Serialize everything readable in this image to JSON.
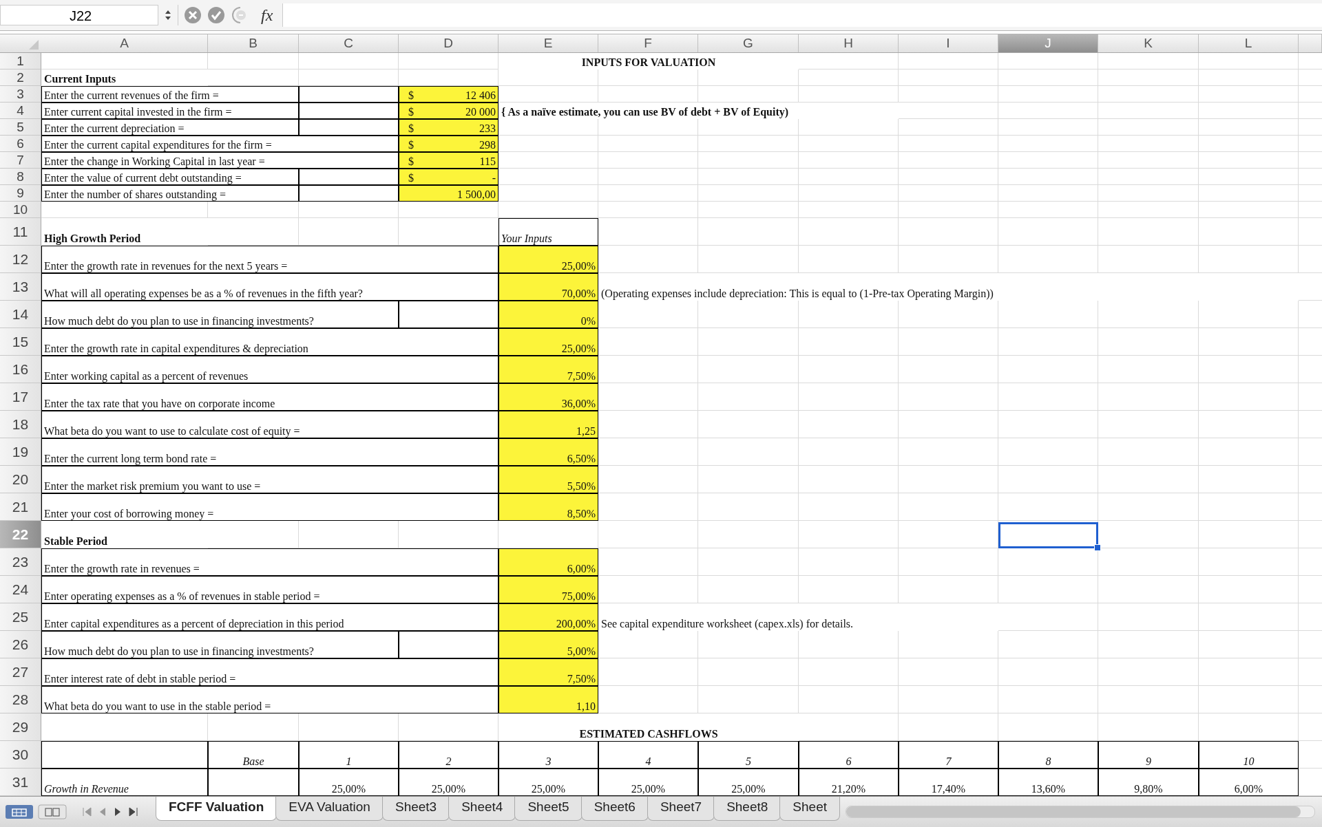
{
  "formula_bar": {
    "name_box": "J22",
    "fx_label": "fx"
  },
  "columns": [
    {
      "label": "A",
      "selected": false
    },
    {
      "label": "B",
      "selected": false
    },
    {
      "label": "C",
      "selected": false
    },
    {
      "label": "D",
      "selected": false
    },
    {
      "label": "E",
      "selected": false
    },
    {
      "label": "F",
      "selected": false
    },
    {
      "label": "G",
      "selected": false
    },
    {
      "label": "H",
      "selected": false
    },
    {
      "label": "I",
      "selected": false
    },
    {
      "label": "J",
      "selected": true
    },
    {
      "label": "K",
      "selected": false
    },
    {
      "label": "L",
      "selected": false
    }
  ],
  "rows": [
    {
      "number": "1",
      "selected": false,
      "cells": [
        {
          "kind": "blank"
        },
        {
          "kind": "blank"
        },
        {
          "kind": "blank"
        },
        {
          "kind": "blank"
        },
        {
          "kind": "title",
          "text": "INPUTS FOR VALUATION"
        },
        {
          "kind": "merged"
        },
        {
          "kind": "merged"
        }
      ]
    },
    {
      "number": "2",
      "selected": false,
      "cells": [
        {
          "kind": "heading",
          "text": "Current Inputs"
        }
      ]
    },
    {
      "number": "3",
      "selected": false,
      "cells": [
        {
          "kind": "label",
          "text": "Enter the current revenues of the firm ="
        },
        {
          "kind": "merged"
        },
        {
          "kind": "box"
        },
        {
          "kind": "money",
          "symbol": "$",
          "text": "12 406"
        }
      ]
    },
    {
      "number": "4",
      "selected": false,
      "cells": [
        {
          "kind": "label",
          "text": "Enter current capital invested in the firm ="
        },
        {
          "kind": "merged"
        },
        {
          "kind": "box"
        },
        {
          "kind": "money",
          "symbol": "$",
          "text": "20 000"
        },
        {
          "kind": "bold_note",
          "text": "{ As a naïve estimate, you can use BV of debt + BV of Equity)"
        },
        {
          "kind": "merged"
        },
        {
          "kind": "merged"
        },
        {
          "kind": "merged"
        }
      ]
    },
    {
      "number": "5",
      "selected": false,
      "cells": [
        {
          "kind": "label",
          "text": "Enter the current depreciation ="
        },
        {
          "kind": "merged"
        },
        {
          "kind": "box"
        },
        {
          "kind": "money",
          "symbol": "$",
          "text": "233"
        }
      ]
    },
    {
      "number": "6",
      "selected": false,
      "cells": [
        {
          "kind": "label",
          "text": "Enter the current capital expenditures for the firm ="
        },
        {
          "kind": "merged"
        },
        {
          "kind": "merged"
        },
        {
          "kind": "money",
          "symbol": "$",
          "text": "298"
        }
      ]
    },
    {
      "number": "7",
      "selected": false,
      "cells": [
        {
          "kind": "label",
          "text": "Enter the change in Working Capital in last year ="
        },
        {
          "kind": "merged"
        },
        {
          "kind": "merged"
        },
        {
          "kind": "money",
          "symbol": "$",
          "text": "115"
        }
      ]
    },
    {
      "number": "8",
      "selected": false,
      "cells": [
        {
          "kind": "label",
          "text": "Enter the value of current debt outstanding ="
        },
        {
          "kind": "merged"
        },
        {
          "kind": "box"
        },
        {
          "kind": "money",
          "symbol": "$",
          "text": "-"
        }
      ]
    },
    {
      "number": "9",
      "selected": false,
      "cells": [
        {
          "kind": "label",
          "text": "Enter the number of shares outstanding ="
        },
        {
          "kind": "merged"
        },
        {
          "kind": "box"
        },
        {
          "kind": "input",
          "text": "1 500,00"
        }
      ]
    },
    {
      "number": "10",
      "selected": false,
      "cells": []
    },
    {
      "number": "11",
      "selected": false,
      "cells": [
        {
          "kind": "heading",
          "text": "High Growth Period"
        },
        {
          "kind": "blank"
        },
        {
          "kind": "blank"
        },
        {
          "kind": "blank"
        },
        {
          "kind": "italic_box",
          "text": "Your Inputs"
        }
      ]
    },
    {
      "number": "12",
      "selected": false,
      "cells": [
        {
          "kind": "label",
          "text": "Enter the growth rate in revenues for the next 5 years ="
        },
        {
          "kind": "merged"
        },
        {
          "kind": "merged"
        },
        {
          "kind": "merged"
        },
        {
          "kind": "input",
          "text": "25,00%"
        }
      ]
    },
    {
      "number": "13",
      "selected": false,
      "cells": [
        {
          "kind": "label",
          "text": "What will all operating expenses be as a % of revenues in the fifth year?"
        },
        {
          "kind": "merged"
        },
        {
          "kind": "merged"
        },
        {
          "kind": "merged"
        },
        {
          "kind": "input",
          "text": "70,00%"
        },
        {
          "kind": "note",
          "text": "(Operating expenses include depreciation: This is equal to (1-Pre-tax Operating Margin))"
        },
        {
          "kind": "merged"
        },
        {
          "kind": "merged"
        },
        {
          "kind": "merged"
        },
        {
          "kind": "merged"
        },
        {
          "kind": "merged"
        },
        {
          "kind": "merged"
        }
      ]
    },
    {
      "number": "14",
      "selected": false,
      "cells": [
        {
          "kind": "label",
          "text": "How much debt do you plan to use in financing investments?"
        },
        {
          "kind": "merged"
        },
        {
          "kind": "merged"
        },
        {
          "kind": "box"
        },
        {
          "kind": "input",
          "text": "0%"
        }
      ]
    },
    {
      "number": "15",
      "selected": false,
      "cells": [
        {
          "kind": "label",
          "text": "Enter the growth rate in capital expenditures & depreciation"
        },
        {
          "kind": "merged"
        },
        {
          "kind": "merged"
        },
        {
          "kind": "merged"
        },
        {
          "kind": "input",
          "text": "25,00%"
        }
      ]
    },
    {
      "number": "16",
      "selected": false,
      "cells": [
        {
          "kind": "label",
          "text": "Enter working capital as a percent of revenues"
        },
        {
          "kind": "merged"
        },
        {
          "kind": "merged"
        },
        {
          "kind": "merged"
        },
        {
          "kind": "input",
          "text": "7,50%"
        }
      ]
    },
    {
      "number": "17",
      "selected": false,
      "cells": [
        {
          "kind": "label",
          "text": "Enter the tax rate that you have on corporate income"
        },
        {
          "kind": "merged"
        },
        {
          "kind": "merged"
        },
        {
          "kind": "merged"
        },
        {
          "kind": "input",
          "text": "36,00%"
        }
      ]
    },
    {
      "number": "18",
      "selected": false,
      "cells": [
        {
          "kind": "label",
          "text": "What beta do you want to use to calculate cost of equity ="
        },
        {
          "kind": "merged"
        },
        {
          "kind": "merged"
        },
        {
          "kind": "merged"
        },
        {
          "kind": "input",
          "text": "1,25"
        }
      ]
    },
    {
      "number": "19",
      "selected": false,
      "cells": [
        {
          "kind": "label",
          "text": "Enter the current long term bond rate ="
        },
        {
          "kind": "merged"
        },
        {
          "kind": "merged"
        },
        {
          "kind": "merged"
        },
        {
          "kind": "input",
          "text": "6,50%"
        }
      ]
    },
    {
      "number": "20",
      "selected": false,
      "cells": [
        {
          "kind": "label",
          "text": "Enter the market risk premium you want to use ="
        },
        {
          "kind": "merged"
        },
        {
          "kind": "merged"
        },
        {
          "kind": "merged"
        },
        {
          "kind": "input",
          "text": "5,50%"
        }
      ]
    },
    {
      "number": "21",
      "selected": false,
      "cells": [
        {
          "kind": "label",
          "text": "Enter your cost of borrowing money ="
        },
        {
          "kind": "merged"
        },
        {
          "kind": "merged"
        },
        {
          "kind": "merged"
        },
        {
          "kind": "input",
          "text": "8,50%"
        }
      ]
    },
    {
      "number": "22",
      "selected": true,
      "cells": [
        {
          "kind": "heading",
          "text": "Stable Period"
        },
        {
          "kind": "blank"
        },
        {
          "kind": "blank"
        },
        {
          "kind": "blank"
        },
        {
          "kind": "blank"
        },
        {
          "kind": "blank"
        },
        {
          "kind": "blank"
        },
        {
          "kind": "blank"
        },
        {
          "kind": "blank"
        },
        {
          "kind": "cursor"
        }
      ]
    },
    {
      "number": "23",
      "selected": false,
      "cells": [
        {
          "kind": "label",
          "text": "Enter the growth rate in revenues ="
        },
        {
          "kind": "merged"
        },
        {
          "kind": "merged"
        },
        {
          "kind": "merged"
        },
        {
          "kind": "input",
          "text": "6,00%"
        }
      ]
    },
    {
      "number": "24",
      "selected": false,
      "cells": [
        {
          "kind": "label",
          "text": "Enter operating expenses as a % of revenues in stable period ="
        },
        {
          "kind": "merged"
        },
        {
          "kind": "merged"
        },
        {
          "kind": "merged"
        },
        {
          "kind": "input",
          "text": "75,00%"
        }
      ]
    },
    {
      "number": "25",
      "selected": false,
      "cells": [
        {
          "kind": "label",
          "text": "Enter capital expenditures as a percent of depreciation in this period"
        },
        {
          "kind": "merged"
        },
        {
          "kind": "merged"
        },
        {
          "kind": "merged"
        },
        {
          "kind": "input",
          "text": "200,00%"
        },
        {
          "kind": "note",
          "text": "See capital expenditure worksheet (capex.xls) for details."
        },
        {
          "kind": "merged"
        },
        {
          "kind": "merged"
        },
        {
          "kind": "merged"
        }
      ]
    },
    {
      "number": "26",
      "selected": false,
      "cells": [
        {
          "kind": "label",
          "text": "How much debt do you plan to use in financing investments?"
        },
        {
          "kind": "merged"
        },
        {
          "kind": "merged"
        },
        {
          "kind": "box"
        },
        {
          "kind": "input",
          "text": "5,00%"
        }
      ]
    },
    {
      "number": "27",
      "selected": false,
      "cells": [
        {
          "kind": "label",
          "text": "Enter interest rate of debt in stable period ="
        },
        {
          "kind": "merged"
        },
        {
          "kind": "merged"
        },
        {
          "kind": "merged"
        },
        {
          "kind": "input",
          "text": "7,50%"
        }
      ]
    },
    {
      "number": "28",
      "selected": false,
      "cells": [
        {
          "kind": "label",
          "text": "What beta do you want to use in the stable period ="
        },
        {
          "kind": "merged"
        },
        {
          "kind": "merged"
        },
        {
          "kind": "merged"
        },
        {
          "kind": "input",
          "text": "1,10"
        }
      ]
    },
    {
      "number": "29",
      "selected": false,
      "cells": [
        {
          "kind": "blank"
        },
        {
          "kind": "blank"
        },
        {
          "kind": "blank"
        },
        {
          "kind": "blank"
        },
        {
          "kind": "title",
          "text": "ESTIMATED CASHFLOWS"
        },
        {
          "kind": "merged"
        },
        {
          "kind": "merged"
        }
      ]
    },
    {
      "number": "30",
      "selected": false,
      "cells": [
        {
          "kind": "box"
        },
        {
          "kind": "italic_head",
          "text": "Base"
        },
        {
          "kind": "italic_head",
          "text": "1"
        },
        {
          "kind": "italic_head",
          "text": "2"
        },
        {
          "kind": "italic_head",
          "text": "3"
        },
        {
          "kind": "italic_head",
          "text": "4"
        },
        {
          "kind": "italic_head",
          "text": "5"
        },
        {
          "kind": "italic_head",
          "text": "6"
        },
        {
          "kind": "italic_head",
          "text": "7"
        },
        {
          "kind": "italic_head",
          "text": "8"
        },
        {
          "kind": "italic_head",
          "text": "9"
        },
        {
          "kind": "italic_head",
          "text": "10"
        }
      ]
    },
    {
      "number": "31",
      "selected": false,
      "cells": [
        {
          "kind": "italic_box",
          "text": "Growth in Revenue"
        },
        {
          "kind": "box"
        },
        {
          "kind": "number",
          "text": "25,00%"
        },
        {
          "kind": "number",
          "text": "25,00%"
        },
        {
          "kind": "number",
          "text": "25,00%"
        },
        {
          "kind": "number",
          "text": "25,00%"
        },
        {
          "kind": "number",
          "text": "25,00%"
        },
        {
          "kind": "number",
          "text": "21,20%"
        },
        {
          "kind": "number",
          "text": "17,40%"
        },
        {
          "kind": "number",
          "text": "13,60%"
        },
        {
          "kind": "number",
          "text": "9,80%"
        },
        {
          "kind": "number",
          "text": "6,00%"
        }
      ]
    }
  ],
  "sheet_tabs": [
    {
      "label": "FCFF Valuation",
      "selected": true
    },
    {
      "label": "EVA Valuation",
      "selected": false
    },
    {
      "label": "Sheet3",
      "selected": false
    },
    {
      "label": "Sheet4",
      "selected": false
    },
    {
      "label": "Sheet5",
      "selected": false
    },
    {
      "label": "Sheet6",
      "selected": false
    },
    {
      "label": "Sheet7",
      "selected": false
    },
    {
      "label": "Sheet8",
      "selected": false
    },
    {
      "label": "Sheet",
      "selected": false
    }
  ]
}
